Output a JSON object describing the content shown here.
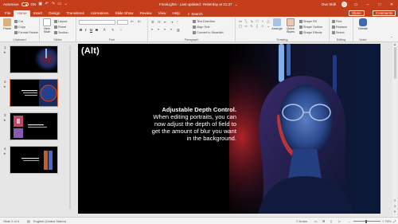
{
  "titlebar": {
    "autosave_label": "AutoSave",
    "autosave_state": "ON",
    "doc_title": "FinalLights - Last updated: Yesterday at 21:37",
    "user_name": "Ove Skål"
  },
  "tabs": [
    "File",
    "Home",
    "Insert",
    "Design",
    "Transitions",
    "Animations",
    "Slide Show",
    "Review",
    "View",
    "Help"
  ],
  "active_tab": "Home",
  "tell_me": "Search",
  "share_label": "Share",
  "comments_label": "Comments",
  "ribbon": {
    "clipboard": {
      "paste": "Paste",
      "cut": "Cut",
      "copy": "Copy",
      "format_painter": "Format Painter",
      "label": "Clipboard"
    },
    "slides": {
      "new_slide": "New Slide",
      "layout": "Layout",
      "reset": "Reset",
      "section": "Section",
      "label": "Slides"
    },
    "font": {
      "label": "Font",
      "bold": "B",
      "italic": "I",
      "underline": "U",
      "strike": "S"
    },
    "paragraph": {
      "label": "Paragraph",
      "text_direction": "Text Direction",
      "align_text": "Align Text",
      "convert_smartart": "Convert to SmartArt"
    },
    "drawing": {
      "label": "Drawing",
      "arrange": "Arrange",
      "quick_styles": "Quick Styles",
      "shape_fill": "Shape Fill",
      "shape_outline": "Shape Outline",
      "shape_effects": "Shape Effects"
    },
    "editing": {
      "label": "Editing",
      "find": "Find",
      "replace": "Replace",
      "select": "Select"
    },
    "voice": {
      "dictate": "Dictate",
      "label": "Voice"
    }
  },
  "thumbnails": [
    {
      "number": "1",
      "has_star": true
    },
    {
      "number": "2",
      "has_star": true,
      "selected": true
    },
    {
      "number": "3",
      "has_star": true
    },
    {
      "number": "4",
      "has_star": true
    }
  ],
  "slide": {
    "alt_label": "(Alt)",
    "heading": "Adjustable Depth Control.",
    "body": "When editing portraits, you can now adjust the depth of field to get the amount of blur you want in the background."
  },
  "status": {
    "slide_of": "Slide 2 of 4",
    "language": "English (United States)",
    "notes": "Notes",
    "zoom": "+ 79%"
  },
  "colors": {
    "accent": "#c43e1c",
    "selected_thumb": "#e5793d"
  }
}
